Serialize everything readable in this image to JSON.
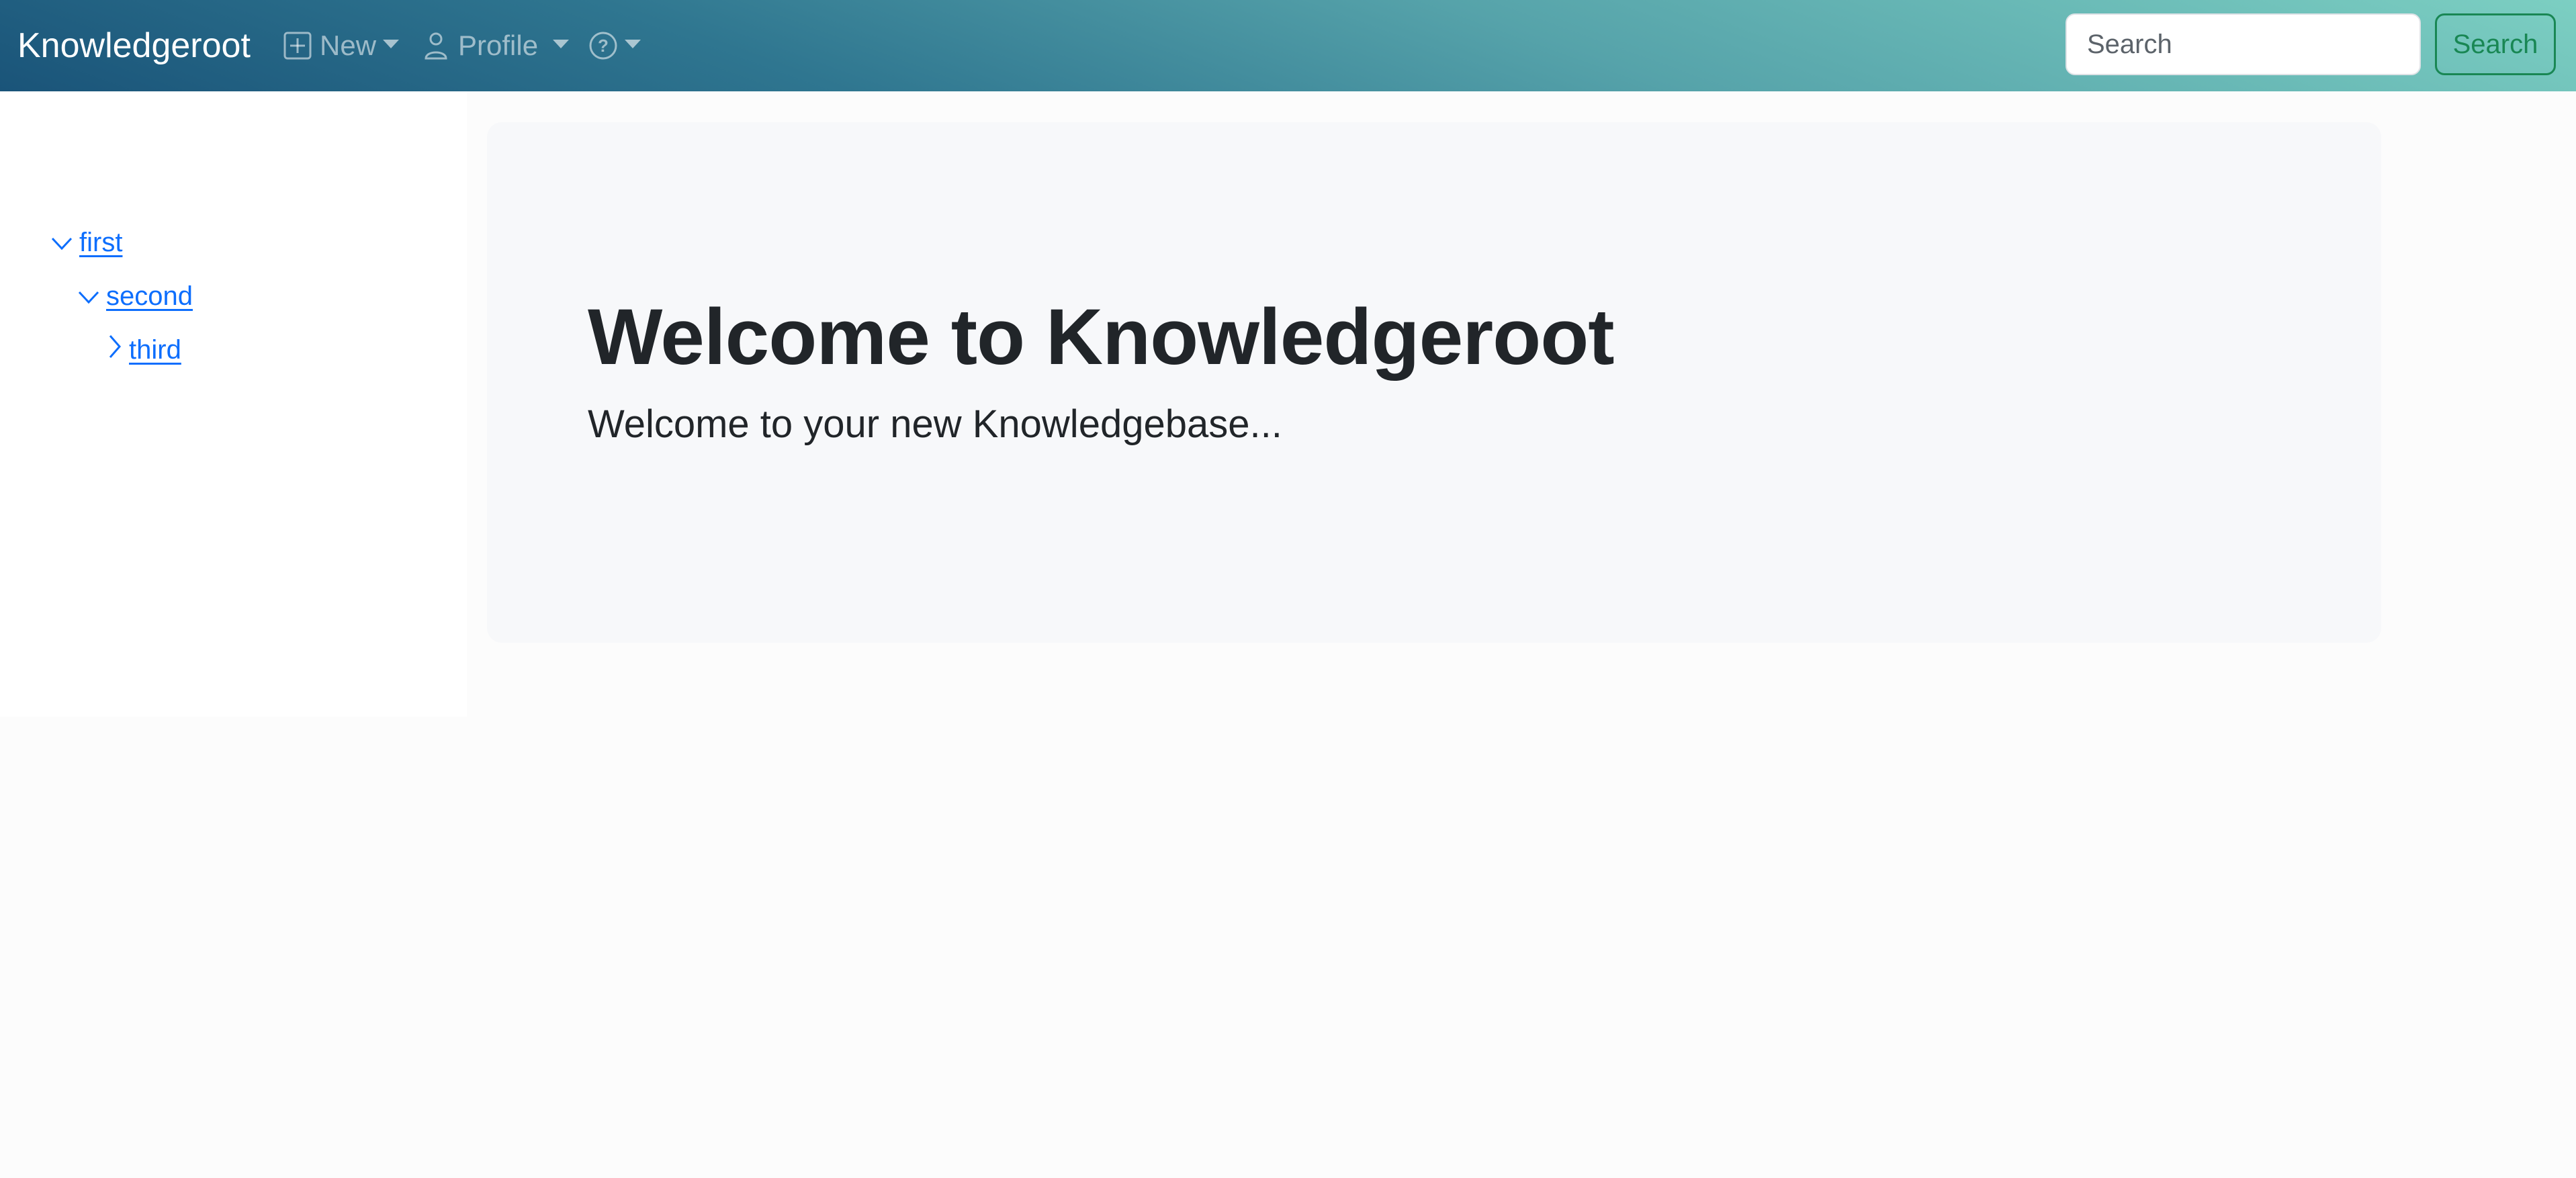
{
  "navbar": {
    "brand": "Knowledgeroot",
    "items": [
      {
        "id": "new",
        "label": "New",
        "icon": "plus-square-icon",
        "has_dropdown": true
      },
      {
        "id": "profile",
        "label": "Profile",
        "icon": "person-icon",
        "has_dropdown": true
      },
      {
        "id": "help",
        "label": "",
        "icon": "question-circle-icon",
        "has_dropdown": true
      }
    ],
    "search": {
      "placeholder": "Search",
      "value": "",
      "button_label": "Search"
    }
  },
  "sidebar": {
    "tree": [
      {
        "label": "first",
        "level": 0,
        "expanded": true,
        "icon": "chevron-down-icon"
      },
      {
        "label": "second",
        "level": 1,
        "expanded": true,
        "icon": "chevron-down-icon"
      },
      {
        "label": "third",
        "level": 2,
        "expanded": false,
        "icon": "chevron-right-icon"
      }
    ]
  },
  "main": {
    "title": "Welcome to Knowledgeroot",
    "lead": "Welcome to your new Knowledgebase..."
  },
  "colors": {
    "navbar_gradient_start": "#1a5479",
    "navbar_gradient_end": "#7ccfc2",
    "link": "#0d6efd",
    "search_button": "#198754",
    "jumbotron_bg": "#f7f8fa",
    "text": "#212529"
  }
}
